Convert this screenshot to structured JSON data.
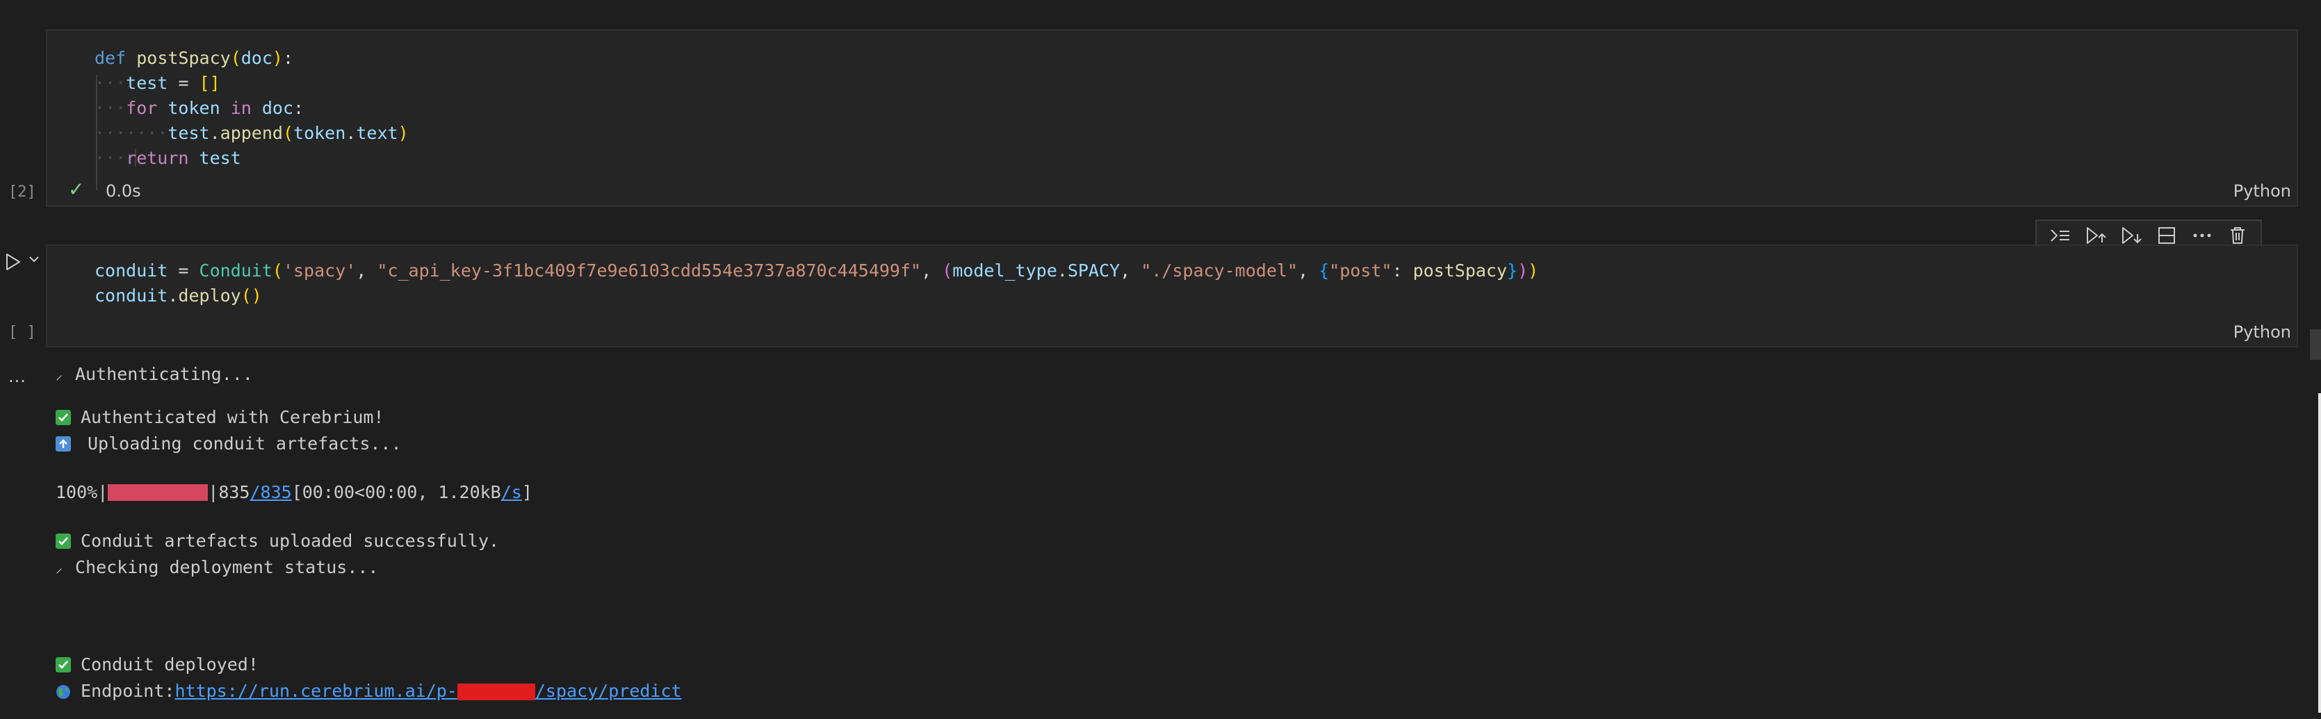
{
  "cell1": {
    "exec_count": "[2]",
    "status_time": "0.0s",
    "language": "Python",
    "code": {
      "kw_def": "def",
      "fn_name": "postSpacy",
      "param": "doc",
      "var_test": "test",
      "eq": "=",
      "empty_list": "[]",
      "kw_for": "for",
      "var_token": "token",
      "kw_in": "in",
      "fn_append": "append",
      "attr_text": "text",
      "kw_return": "return"
    }
  },
  "cell2": {
    "exec_count": "[ ]",
    "language": "Python",
    "code": {
      "var_conduit": "conduit",
      "cls_conduit": "Conduit",
      "str_spacy": "'spacy'",
      "str_key": "\"c_api_key-3f1bc409f7e9e6103cdd554e3737a870c445499f\"",
      "var_model_type": "model_type",
      "attr_spacy": "SPACY",
      "str_path": "\"./spacy-model\"",
      "str_post": "\"post\"",
      "fn_post_spacy": "postSpacy",
      "fn_deploy": "deploy"
    }
  },
  "toolbar": {
    "icons": [
      "run-above-icon",
      "run-cell-above-icon",
      "run-cell-below-icon",
      "split-cell-icon",
      "more-actions-icon",
      "delete-cell-icon"
    ]
  },
  "output": {
    "dots": "...",
    "spinner_glyph": "⸝",
    "authenticating": "Authenticating...",
    "authenticated": "Authenticated with Cerebrium!",
    "uploading": "Uploading conduit artefacts...",
    "progress_percent_label": "100%|",
    "progress_fraction": 1.0,
    "progress_sep": "|",
    "progress_count": "835",
    "progress_total_link": "/835",
    "progress_timing_pre": "[00:00<00:00, 1.20kB",
    "progress_rate_link": "/s",
    "progress_close": "]",
    "uploaded": "Conduit artefacts uploaded successfully.",
    "checking": "Checking deployment status...",
    "deployed": "Conduit deployed!",
    "endpoint_label": "Endpoint:",
    "endpoint_prefix": "https://run.cerebrium.ai/p-",
    "endpoint_suffix": "/spacy/predict"
  },
  "colors": {
    "background": "#1e1e1e",
    "cell_background": "#252526",
    "success": "#89d185",
    "progress": "#d6475f",
    "link": "#4a9fff"
  }
}
